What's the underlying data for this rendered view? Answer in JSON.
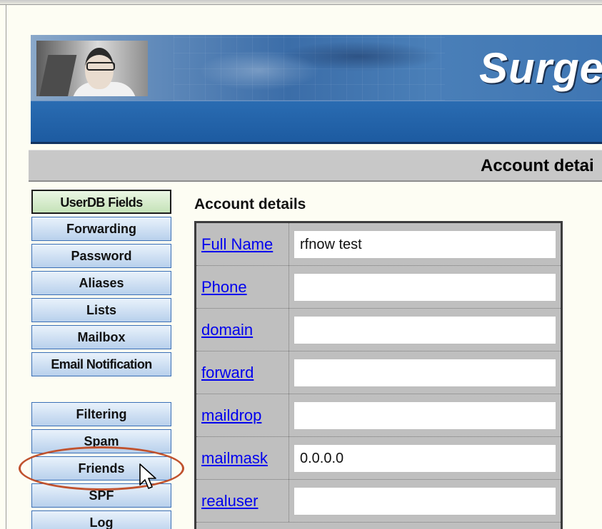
{
  "banner": {
    "title": "Surge"
  },
  "section": {
    "title": "Account detai"
  },
  "content": {
    "heading": "Account details"
  },
  "menu": {
    "group1": [
      {
        "label": "UserDB Fields",
        "active": true
      },
      {
        "label": "Forwarding"
      },
      {
        "label": "Password"
      },
      {
        "label": "Aliases"
      },
      {
        "label": "Lists"
      },
      {
        "label": "Mailbox"
      },
      {
        "label": "Email Notification"
      }
    ],
    "group2": [
      {
        "label": "Filtering"
      },
      {
        "label": "Spam"
      },
      {
        "label": "Friends",
        "highlighted": true
      },
      {
        "label": "SPF"
      },
      {
        "label": "Log"
      }
    ]
  },
  "fields": [
    {
      "label": "Full Name",
      "value": "rfnow test"
    },
    {
      "label": "Phone",
      "value": ""
    },
    {
      "label": "domain",
      "value": ""
    },
    {
      "label": "forward",
      "value": ""
    },
    {
      "label": "maildrop",
      "value": ""
    },
    {
      "label": "mailmask",
      "value": "0.0.0.0"
    },
    {
      "label": "realuser",
      "value": ""
    }
  ],
  "colors": {
    "link": "#0000ee",
    "highlight_ring": "#c0522e",
    "menu_border": "#3a6fb6",
    "active_menu_bg": "#c5e2b8"
  },
  "icons": {
    "cursor": "arrow-pointer-icon"
  }
}
